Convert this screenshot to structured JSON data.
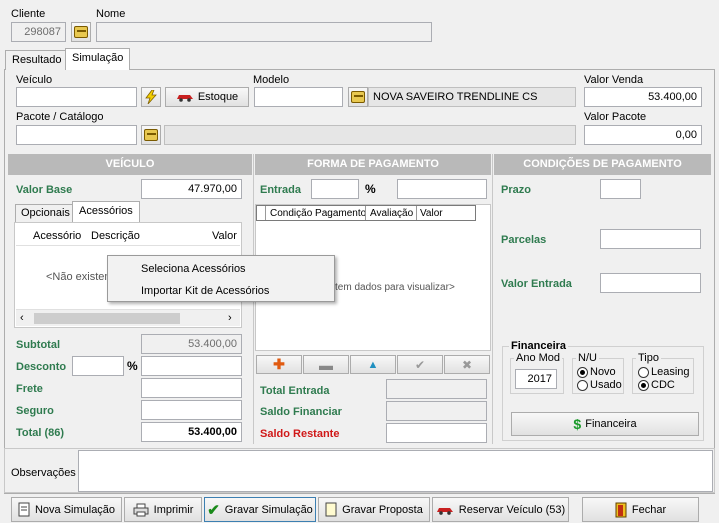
{
  "header": {
    "cliente_label": "Cliente",
    "cliente_value": "298087",
    "nome_label": "Nome",
    "nome_value": ""
  },
  "tabs": [
    {
      "label": "Resultado"
    },
    {
      "label": "Simulação"
    }
  ],
  "veiculo_row": {
    "veiculo_label": "Veículo",
    "veiculo_value": "",
    "estoque_label": "Estoque",
    "modelo_label": "Modelo",
    "modelo_code": "",
    "modelo_desc": "NOVA SAVEIRO TRENDLINE CS",
    "valor_venda_label": "Valor Venda",
    "valor_venda_value": "53.400,00"
  },
  "pacote_row": {
    "pacote_label": "Pacote / Catálogo",
    "pacote_value": "",
    "pacote_desc": "",
    "valor_pacote_label": "Valor Pacote",
    "valor_pacote_value": "0,00"
  },
  "veiculo_section": {
    "title": "VEÍCULO",
    "valor_base_label": "Valor Base",
    "valor_base_value": "47.970,00",
    "subtabs": [
      {
        "label": "Opcionais"
      },
      {
        "label": "Acessórios"
      }
    ],
    "grid_headers": [
      "Acessório",
      "Descrição",
      "Valor"
    ],
    "grid_empty": "<Não existem",
    "subtotal_label": "Subtotal",
    "subtotal_value": "53.400,00",
    "desconto_label": "Desconto",
    "desconto_pct": "",
    "percent_symbol": "%",
    "desconto_value": "",
    "frete_label": "Frete",
    "frete_value": "",
    "seguro_label": "Seguro",
    "seguro_value": "",
    "total_label": "Total (86)",
    "total_value": "53.400,00"
  },
  "context_menu": {
    "items": [
      {
        "label": "Seleciona Acessórios"
      },
      {
        "label": "Importar Kit de Acessórios"
      }
    ]
  },
  "pagamento_section": {
    "title": "FORMA DE PAGAMENTO",
    "entrada_label": "Entrada",
    "entrada_pct": "",
    "percent_symbol": "%",
    "entrada_value": "",
    "grid_headers": [
      "Condição Pagamento",
      "Avaliação",
      "Valor"
    ],
    "grid_empty": "stem dados para visualizar>",
    "total_entrada_label": "Total Entrada",
    "saldo_financiar_label": "Saldo Financiar",
    "saldo_restante_label": "Saldo Restante"
  },
  "condicoes_section": {
    "title": "CONDIÇÕES DE PAGAMENTO",
    "prazo_label": "Prazo",
    "parcelas_label": "Parcelas",
    "valor_entrada_label": "Valor Entrada",
    "financeira_group_label": "Financeira",
    "ano_mod_label": "Ano Mod",
    "ano_mod_value": "2017",
    "nu_label": "N/U",
    "novo_label": "Novo",
    "usado_label": "Usado",
    "nu_selected": "Novo",
    "tipo_label": "Tipo",
    "leasing_label": "Leasing",
    "cdc_label": "CDC",
    "tipo_selected": "CDC",
    "financeira_button": "Financeira"
  },
  "observacoes": {
    "label": "Observações",
    "value": ""
  },
  "footer": {
    "nova_simulacao": "Nova Simulação",
    "imprimir": "Imprimir",
    "gravar_simulacao": "Gravar Simulação",
    "gravar_proposta": "Gravar Proposta",
    "reservar_veiculo": "Reservar Veículo (53)",
    "fechar": "Fechar"
  },
  "colors": {
    "section_header": "#b9b9b9",
    "green_label": "#2f7b4f",
    "red_label": "#d01818",
    "money_icon": "#1a9a2a"
  }
}
